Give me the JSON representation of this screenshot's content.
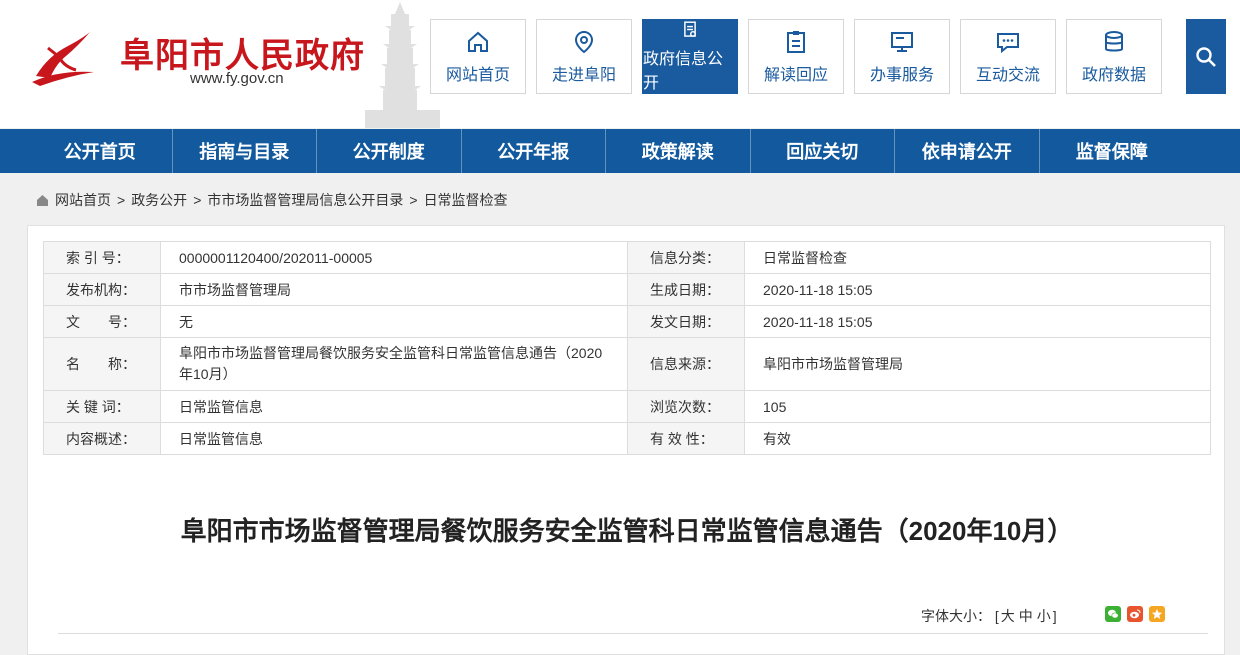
{
  "header": {
    "site_title": "阜阳市人民政府",
    "site_url": "www.fy.gov.cn",
    "search_icon": "search-icon",
    "brand_color": "#1a5a9e",
    "title_color": "#c8161d"
  },
  "top_nav": [
    {
      "label": "网站首页",
      "icon": "home-icon"
    },
    {
      "label": "走进阜阳",
      "icon": "location-pin-icon"
    },
    {
      "label": "政府信息公开",
      "icon": "document-icon"
    },
    {
      "label": "解读回应",
      "icon": "clipboard-icon"
    },
    {
      "label": "办事服务",
      "icon": "monitor-icon"
    },
    {
      "label": "互动交流",
      "icon": "chat-icon"
    },
    {
      "label": "政府数据",
      "icon": "database-icon"
    }
  ],
  "main_nav": [
    "公开首页",
    "指南与目录",
    "公开制度",
    "公开年报",
    "政策解读",
    "回应关切",
    "依申请公开",
    "监督保障"
  ],
  "breadcrumb": [
    "网站首页",
    "政务公开",
    "市市场监督管理局信息公开目录",
    "日常监督检查"
  ],
  "meta": [
    {
      "k1": "索 引 号：",
      "v1": "0000001120400/202011-00005",
      "k2": "信息分类：",
      "v2": "日常监督检查"
    },
    {
      "k1": "发布机构：",
      "v1": "市市场监督管理局",
      "k2": "生成日期：",
      "v2": "2020-11-18 15:05"
    },
    {
      "k1": "文　　号：",
      "v1": "无",
      "k2": "发文日期：",
      "v2": "2020-11-18 15:05"
    },
    {
      "k1": "名　　称：",
      "v1": "阜阳市市场监督管理局餐饮服务安全监管科日常监管信息通告（2020年10月）",
      "k2": "信息来源：",
      "v2": "阜阳市市场监督管理局"
    },
    {
      "k1": "关 键 词：",
      "v1": "日常监管信息",
      "k2": "浏览次数：",
      "v2": "105"
    },
    {
      "k1": "内容概述：",
      "v1": "日常监管信息",
      "k2": "有 效 性：",
      "v2": "有效"
    }
  ],
  "article": {
    "title": "阜阳市市场监督管理局餐饮服务安全监管科日常监管信息通告（2020年10月）",
    "font_size_label": "字体大小：",
    "font_bracket_open": "[",
    "font_large": "大",
    "font_medium": "中",
    "font_small": "小",
    "font_bracket_close": "]"
  },
  "share": [
    {
      "icon": "wechat-icon",
      "color": "#3cb034"
    },
    {
      "icon": "weibo-icon",
      "color": "#e8542e"
    },
    {
      "icon": "qzone-icon",
      "color": "#f5a623"
    }
  ]
}
